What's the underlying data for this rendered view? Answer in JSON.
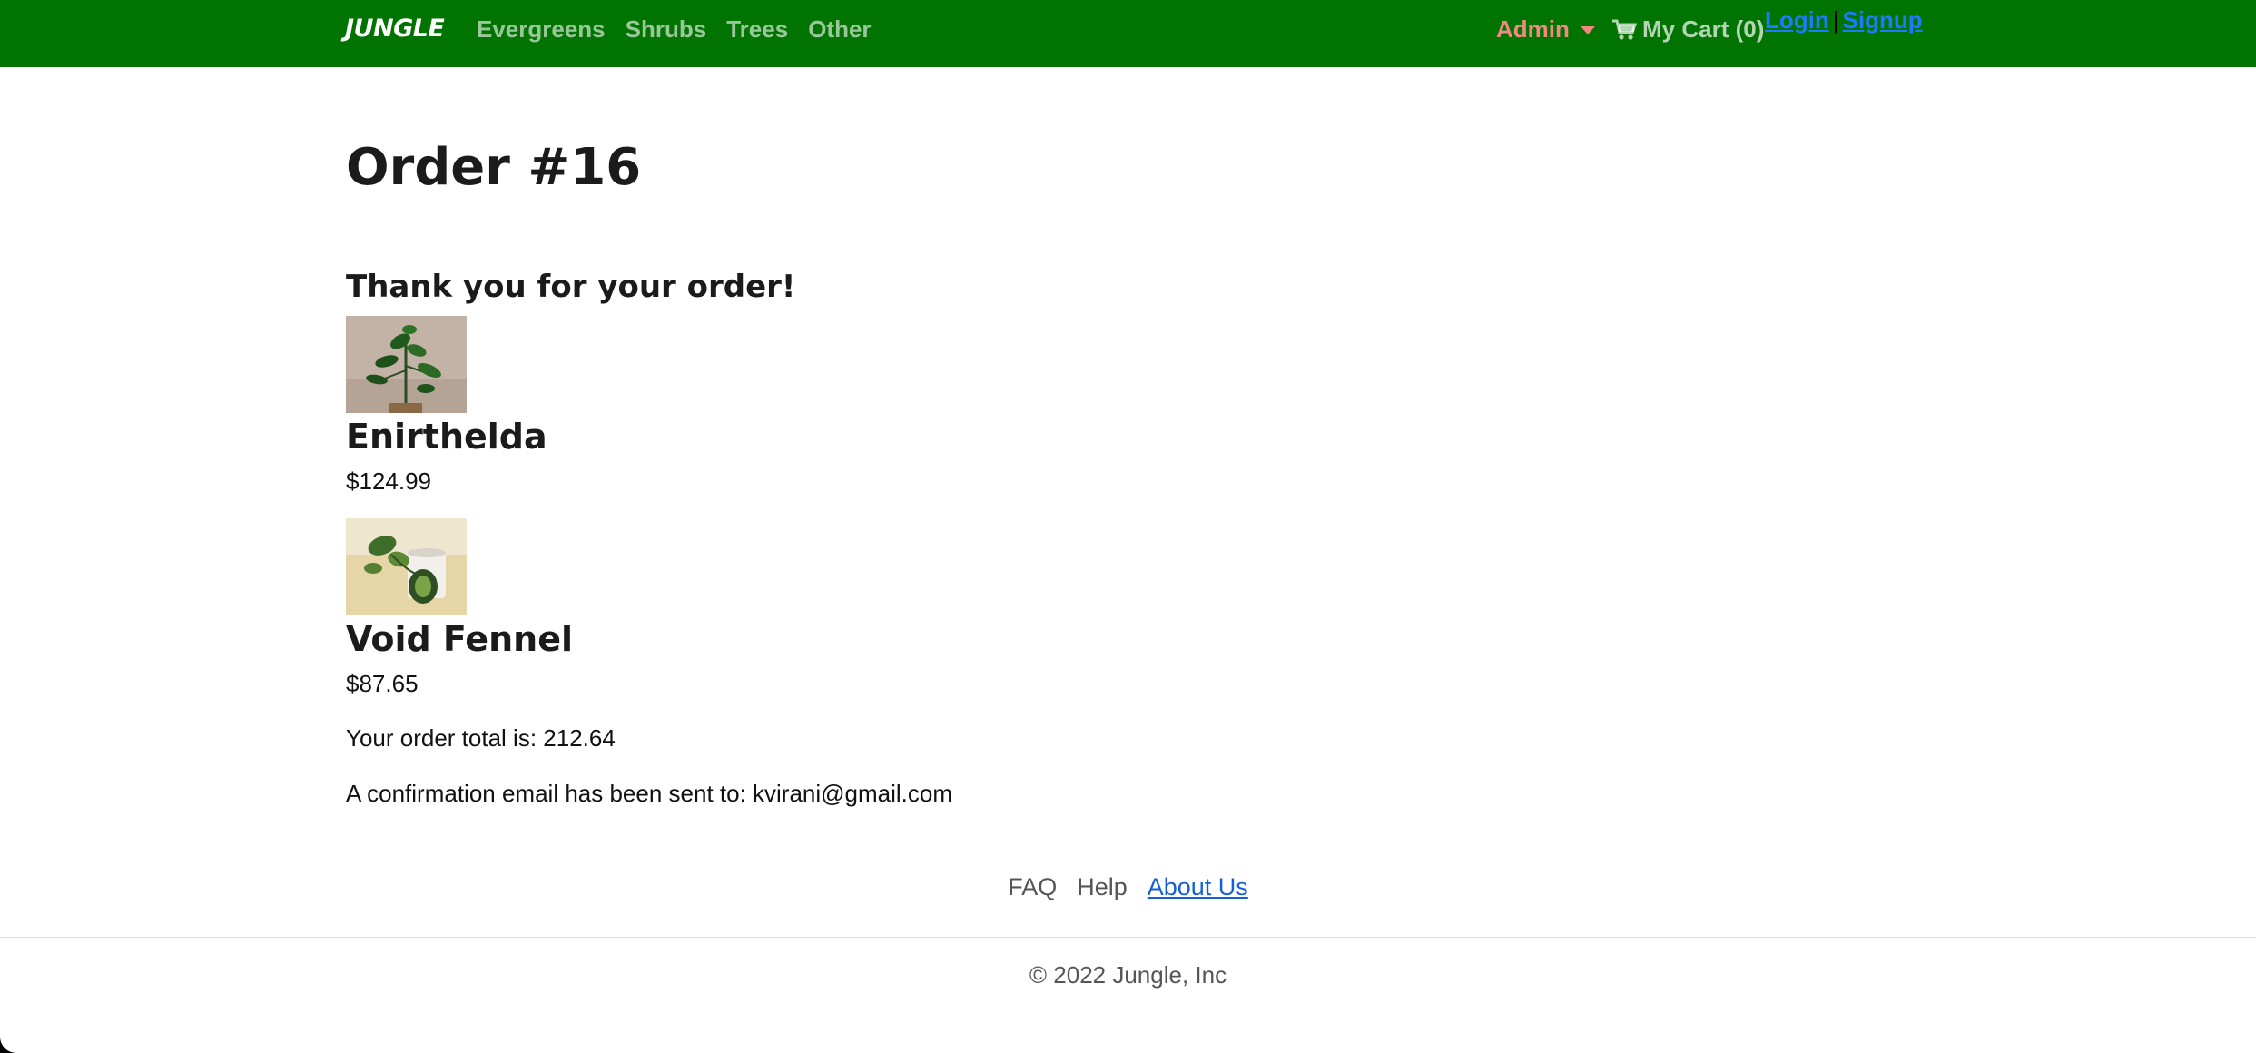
{
  "navbar": {
    "brand": "JUNGLE",
    "links": [
      "Evergreens",
      "Shrubs",
      "Trees",
      "Other"
    ],
    "admin_label": "Admin",
    "cart_label": "My Cart (0)",
    "login_label": "Login",
    "separator": "|",
    "signup_label": "Signup",
    "icons": {
      "cart": "shopping-cart-icon",
      "admin_dropdown": "caret-down-icon"
    },
    "colors": {
      "background": "#007300",
      "admin": "#f08a80",
      "auth_links": "#1a7bff"
    }
  },
  "order": {
    "title": "Order #16",
    "thanks": "Thank you for your order!",
    "items": [
      {
        "name": "Enirthelda",
        "price": "$124.99"
      },
      {
        "name": "Void Fennel",
        "price": "$87.65"
      }
    ],
    "total_text": "Your order total is: 212.64",
    "email_text": "A confirmation email has been sent to: kvirani@gmail.com"
  },
  "footer": {
    "links": [
      "FAQ",
      "Help",
      "About Us"
    ],
    "copyright": "© 2022 Jungle, Inc"
  }
}
